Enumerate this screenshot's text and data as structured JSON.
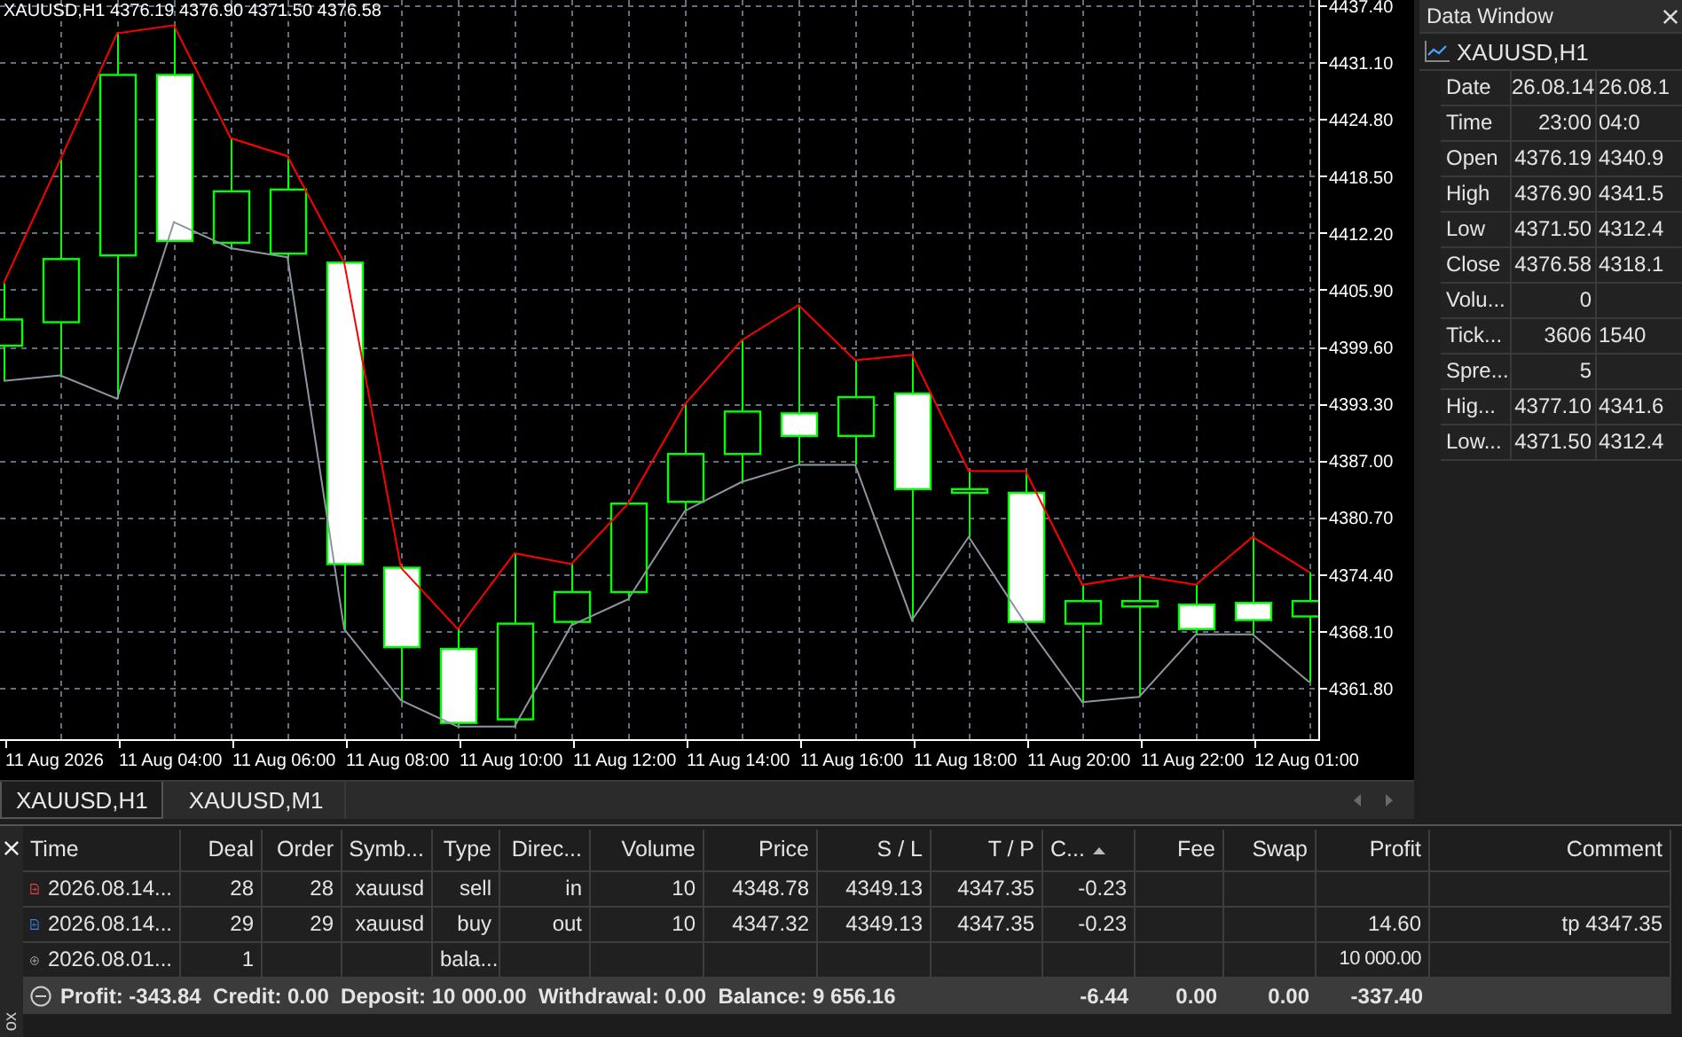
{
  "chart": {
    "legend": "XAUUSD,H1 4376.19 4376.90 4371.50 4376.58",
    "chart_data": {
      "type": "line",
      "grid": true,
      "categories": [
        null,
        "11 Aug 2026",
        null,
        "11 Aug 04:00",
        null,
        "11 Aug 06:00",
        null,
        "11 Aug 08:00",
        null,
        "11 Aug 10:00",
        null,
        "11 Aug 12:00",
        null,
        "11 Aug 14:00",
        null,
        "11 Aug 16:00",
        null,
        "11 Aug 18:00",
        null,
        "11 Aug 20:00",
        null,
        "11 Aug 22:00",
        null,
        "12 Aug 01:00"
      ],
      "ylim": [
        4356.1,
        4438.0
      ],
      "series": [
        {
          "color": "#ff0000",
          "values": [
            4406.6,
            4420.3,
            4434.3,
            4435.2,
            4422.7,
            4420.7,
            4408.9,
            4375.1,
            4368.3,
            4376.7,
            4375.5,
            4382.2,
            4393.2,
            4400.3,
            4404.2,
            4398.1,
            4398.7,
            4385.8,
            4385.8,
            4373.2,
            4374.2,
            4373.2,
            4378.5,
            4374.6
          ]
        },
        {
          "color": "#8c96a0",
          "values": [
            4395.8,
            4396.4,
            4393.8,
            4413.4,
            4410.5,
            4409.5,
            4368.3,
            4360.4,
            4357.5,
            4357.5,
            4368.7,
            4371.6,
            4381.4,
            4384.6,
            4386.5,
            4386.5,
            4369.3,
            4378.5,
            4368.9,
            4360.2,
            4360.8,
            4367.7,
            4367.7,
            4362.4
          ]
        }
      ],
      "yticks": [
        {
          "value": 4437.4,
          "label": "4437.40"
        },
        {
          "value": 4431.1,
          "label": "4431.10"
        },
        {
          "value": 4424.8,
          "label": "4424.80"
        },
        {
          "value": 4418.5,
          "label": "4418.50"
        },
        {
          "value": 4412.2,
          "label": "4412.20"
        },
        {
          "value": 4405.9,
          "label": "4405.90"
        },
        {
          "value": 4399.6,
          "label": "4399.60"
        },
        {
          "value": 4393.3,
          "label": "4393.30"
        },
        {
          "value": 4387.0,
          "label": "4387.00"
        },
        {
          "value": 4380.7,
          "label": "4380.70"
        },
        {
          "value": 4374.4,
          "label": "4374.40"
        },
        {
          "value": 4368.1,
          "label": "4368.10"
        },
        {
          "value": 4361.8,
          "label": "4361.80"
        }
      ]
    }
  },
  "chart_tabs": [
    {
      "label": "XAUUSD,H1",
      "selected": true
    },
    {
      "label": "XAUUSD,M1",
      "selected": false
    }
  ],
  "data_window": {
    "title": "Data Window",
    "symbol": "XAUUSD,H1",
    "rows": [
      {
        "label": "Date",
        "values": [
          "26.08.14",
          "26.08.1"
        ]
      },
      {
        "label": "Time",
        "values": [
          "23:00",
          "04:0"
        ]
      },
      {
        "label": "Open",
        "values": [
          "4376.19",
          "4340.9"
        ]
      },
      {
        "label": "High",
        "values": [
          "4376.90",
          "4341.5"
        ]
      },
      {
        "label": "Low",
        "values": [
          "4371.50",
          "4312.4"
        ]
      },
      {
        "label": "Close",
        "values": [
          "4376.58",
          "4318.1"
        ]
      },
      {
        "label": "Volu...",
        "values": [
          "0"
        ]
      },
      {
        "label": "Tick...",
        "values": [
          "3606",
          "1540"
        ]
      },
      {
        "label": "Spre...",
        "values": [
          "5"
        ]
      },
      {
        "label": "Hig...",
        "values": [
          "4377.10",
          "4341.6"
        ]
      },
      {
        "label": "Low...",
        "values": [
          "4371.50",
          "4312.4"
        ]
      }
    ]
  },
  "toolbox": {
    "side_label": "ox",
    "columns": [
      {
        "label": "Time",
        "sorted": false
      },
      {
        "label": "Deal",
        "sorted": false
      },
      {
        "label": "Order",
        "sorted": false
      },
      {
        "label": "Symb...",
        "sorted": false
      },
      {
        "label": "Type",
        "sorted": false
      },
      {
        "label": "Direc...",
        "sorted": false
      },
      {
        "label": "Volume",
        "sorted": false
      },
      {
        "label": "Price",
        "sorted": false
      },
      {
        "label": "S / L",
        "sorted": false
      },
      {
        "label": "T / P",
        "sorted": false
      },
      {
        "label": "C...",
        "sorted": true
      },
      {
        "label": "Fee",
        "sorted": false
      },
      {
        "label": "Swap",
        "sorted": false
      },
      {
        "label": "Profit",
        "sorted": false
      },
      {
        "label": "Comment",
        "sorted": false
      }
    ],
    "rows": [
      {
        "kind": "sell",
        "cells": [
          "2026.08.14...",
          "28",
          "28",
          "xauusd",
          "sell",
          "in",
          "10",
          "4348.78",
          "4349.13",
          "4347.35",
          "-0.23",
          null,
          null,
          null,
          null
        ]
      },
      {
        "kind": "buy",
        "cells": [
          "2026.08.14...",
          "29",
          "29",
          "xauusd",
          "buy",
          "out",
          "10",
          "4347.32",
          "4349.13",
          "4347.35",
          "-0.23",
          null,
          null,
          "14.60",
          "tp 4347.35"
        ]
      },
      {
        "kind": "balance",
        "cells": [
          "2026.08.01...",
          "1",
          null,
          null,
          "bala...",
          null,
          null,
          null,
          null,
          null,
          null,
          null,
          null,
          "10 000.00",
          null
        ]
      }
    ],
    "summary": {
      "expanded": true,
      "text": "Profit: -343.84  Credit: 0.00  Deposit: 10 000.00  Withdrawal: 0.00  Balance: 9 656.16",
      "cells": [
        "-6.44",
        "0.00",
        "0.00",
        "-337.40"
      ]
    }
  }
}
